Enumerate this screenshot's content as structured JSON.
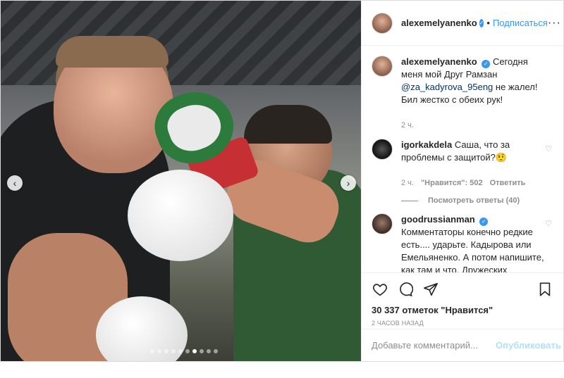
{
  "author": {
    "username": "alexemelyanenko",
    "follow_label": "Подписаться",
    "separator": "•",
    "more_label": "···"
  },
  "carousel": {
    "prev_label": "‹",
    "next_label": "›",
    "slide_count": 10,
    "active_index": 6
  },
  "caption": {
    "username": "alexemelyanenko",
    "text_before": "Сегодня меня мой Друг Рамзан ",
    "mention": "@za_kadyrova_95eng",
    "text_after": " не жалел! Бил жестко с обеих рук!",
    "time": "2 ч."
  },
  "comments": [
    {
      "username": "igorkakdela",
      "text": "Саша, что за проблемы с защитой?🤨",
      "time": "2 ч.",
      "likes": "\"Нравится\": 502",
      "reply_label": "Ответить",
      "view_replies": "Посмотреть ответы (40)"
    },
    {
      "username": "goodrussianman",
      "text": "Комментаторы конечно редкие есть.... ударьте. Кадырова или Емельяненко. А потом напишите, как там и что. Дружеских спаррингов никто не"
    }
  ],
  "likes_text": "30 337 отметок \"Нравится\"",
  "posted_time": "2 часов назад",
  "add_comment": {
    "placeholder": "Добавьте комментарий...",
    "publish_label": "Опубликовать"
  }
}
